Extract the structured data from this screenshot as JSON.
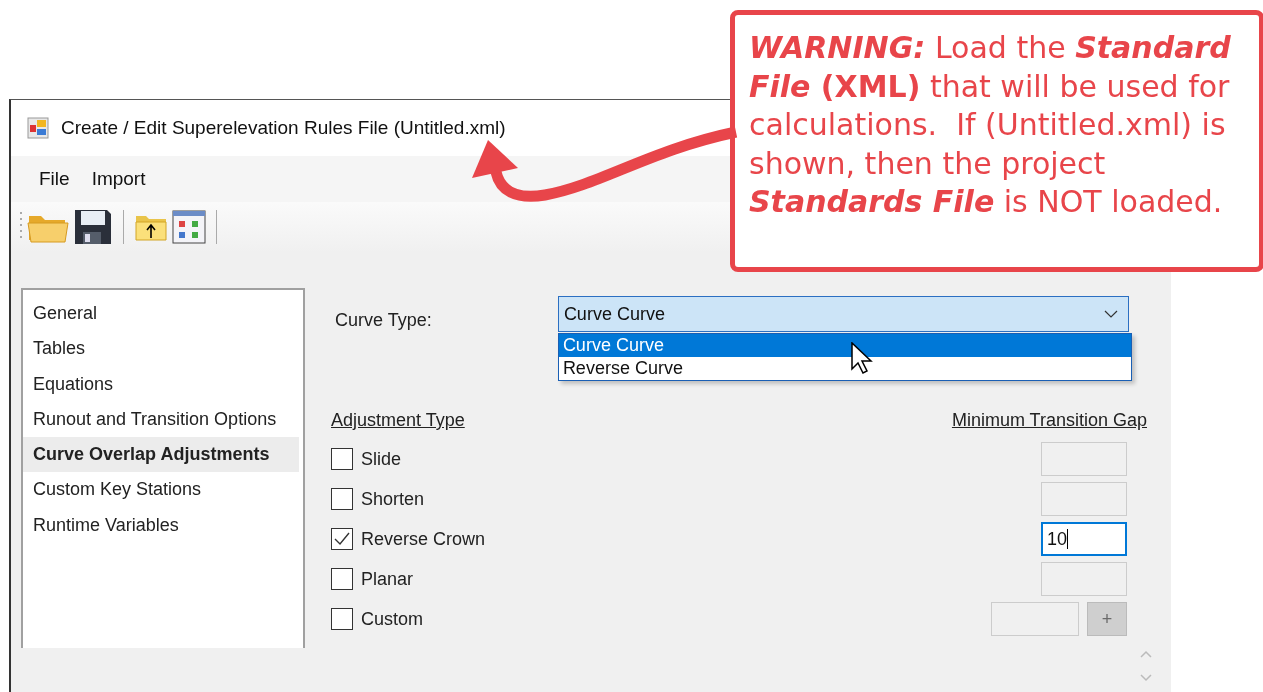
{
  "window": {
    "title": "Create / Edit Superelevation Rules File (Untitled.xml)"
  },
  "menu": [
    "File",
    "Import"
  ],
  "sidebar": {
    "items": [
      {
        "label": "General",
        "selected": false
      },
      {
        "label": "Tables",
        "selected": false
      },
      {
        "label": "Equations",
        "selected": false
      },
      {
        "label": "Runout and Transition Options",
        "selected": false
      },
      {
        "label": "Curve Overlap Adjustments",
        "selected": true
      },
      {
        "label": "Custom Key Stations",
        "selected": false
      },
      {
        "label": "Runtime Variables",
        "selected": false
      }
    ]
  },
  "curve_type": {
    "label": "Curve Type:",
    "value": "Curve Curve",
    "expanded": true,
    "options": [
      {
        "label": "Curve Curve",
        "selected": true
      },
      {
        "label": "Reverse Curve",
        "selected": false
      }
    ]
  },
  "adjustments": {
    "header": "Adjustment Type",
    "gap_header": "Minimum Transition Gap",
    "rows": [
      {
        "kind": "plain",
        "label": "Slide",
        "checked": false,
        "disabled": true
      },
      {
        "kind": "plain",
        "label": "Shorten",
        "checked": false,
        "disabled": true
      },
      {
        "kind": "plain",
        "label": "Reverse Crown",
        "checked": true,
        "disabled": false,
        "value": "10"
      },
      {
        "kind": "plain",
        "label": "Planar",
        "checked": false,
        "disabled": true
      },
      {
        "kind": "custom",
        "label": "Custom",
        "checked": false,
        "disabled": true,
        "button": "+"
      }
    ]
  },
  "callout": {
    "segments": [
      {
        "kind": "bold-italic",
        "text": "WARNING:"
      },
      {
        "kind": "plain",
        "text": " Load the "
      },
      {
        "kind": "bold-italic",
        "text": "Standard File"
      },
      {
        "kind": "bold",
        "text": " (XML)"
      },
      {
        "kind": "plain",
        "text": " that will be used for calculations.  If (Untitled.xml) is shown, then the project "
      },
      {
        "kind": "bold-italic",
        "text": "Standards File"
      },
      {
        "kind": "plain",
        "text": " is NOT loaded."
      }
    ]
  }
}
